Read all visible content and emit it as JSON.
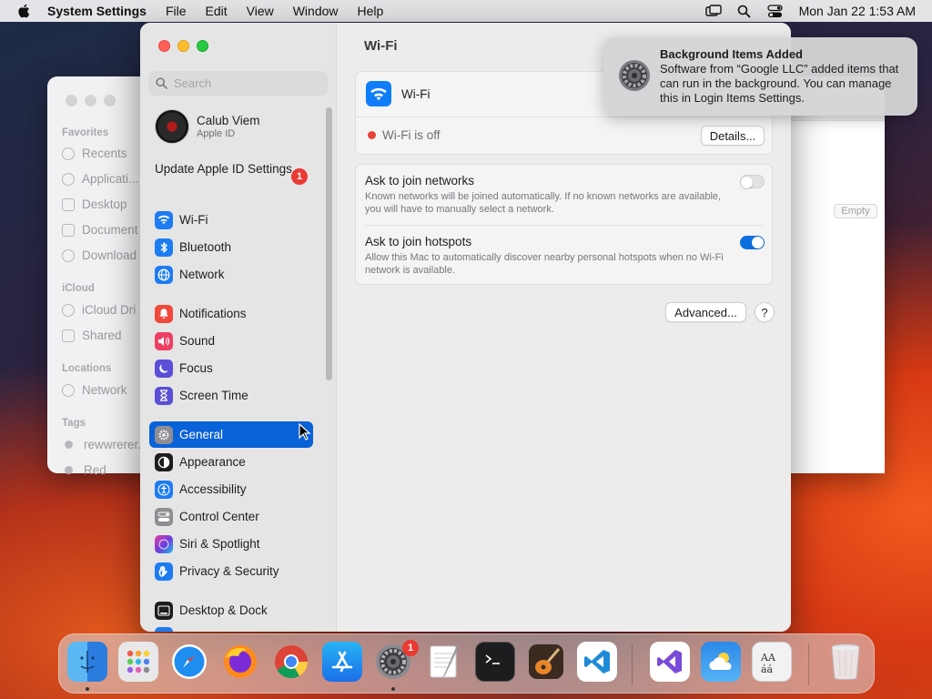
{
  "menubar": {
    "app_name": "System Settings",
    "menus": [
      "File",
      "Edit",
      "View",
      "Window",
      "Help"
    ],
    "clock": "Mon Jan 22  1:53 AM",
    "icons": [
      "screen-mirroring-icon",
      "spotlight-search-icon",
      "control-center-icon"
    ]
  },
  "finder": {
    "sections": {
      "favorites": "Favorites",
      "icloud": "iCloud",
      "locations": "Locations",
      "tags": "Tags"
    },
    "items": {
      "recents": "Recents",
      "applications": "Applicati...",
      "desktop": "Desktop",
      "documents": "Document",
      "downloads": "Download",
      "icloud_drive": "iCloud Dri",
      "shared": "Shared",
      "network": "Network",
      "tag1": "rewwrerer...",
      "tag2": "Red"
    },
    "empty_button": "Empty"
  },
  "settings": {
    "search_placeholder": "Search",
    "account": {
      "name": "Calub Viem",
      "subtitle": "Apple ID"
    },
    "update": {
      "label": "Update Apple ID Settings",
      "badge": "1"
    },
    "nav": [
      {
        "label": "Wi-Fi",
        "icon": "wifi-icon",
        "color": "#1e7cf2"
      },
      {
        "label": "Bluetooth",
        "icon": "bluetooth-icon",
        "color": "#1e7cf2"
      },
      {
        "label": "Network",
        "icon": "globe-icon",
        "color": "#1e7cf2"
      },
      {
        "label": "Notifications",
        "icon": "bell-icon",
        "color": "#f1483c"
      },
      {
        "label": "Sound",
        "icon": "speaker-icon",
        "color": "#ef3e62"
      },
      {
        "label": "Focus",
        "icon": "moon-icon",
        "color": "#5a4fd6"
      },
      {
        "label": "Screen Time",
        "icon": "hourglass-icon",
        "color": "#5a4fd6"
      },
      {
        "label": "General",
        "icon": "gear-icon",
        "color": "#8e8e93"
      },
      {
        "label": "Appearance",
        "icon": "appearance-icon",
        "color": "#1d1d1f"
      },
      {
        "label": "Accessibility",
        "icon": "accessibility-icon",
        "color": "#1e7cf2"
      },
      {
        "label": "Control Center",
        "icon": "control-center-icon",
        "color": "#8e8e93"
      },
      {
        "label": "Siri & Spotlight",
        "icon": "siri-icon",
        "color": "#b03ad8"
      },
      {
        "label": "Privacy & Security",
        "icon": "hand-icon",
        "color": "#1e7cf2"
      },
      {
        "label": "Desktop & Dock",
        "icon": "dock-icon",
        "color": "#1d1d1f"
      }
    ],
    "active_nav": "General",
    "page_title": "Wi-Fi",
    "wifi": {
      "label": "Wi-Fi",
      "status": "Wi-Fi is off",
      "status_color": "#e8443a",
      "details_button": "Details..."
    },
    "options": [
      {
        "title": "Ask to join networks",
        "description": "Known networks will be joined automatically. If no known networks are available, you will have to manually select a network.",
        "enabled": false
      },
      {
        "title": "Ask to join hotspots",
        "description": "Allow this Mac to automatically discover nearby personal hotspots when no Wi-Fi network is available.",
        "enabled": true
      }
    ],
    "advanced_button": "Advanced...",
    "help_button": "?"
  },
  "notification": {
    "title": "Background Items Added",
    "body": "Software from “Google LLC” added items that can run in the background. You can manage this in Login Items Settings.",
    "icon": "gear-icon"
  },
  "dock": {
    "apps": [
      "Finder",
      "Launchpad",
      "Safari",
      "Firefox",
      "Google Chrome",
      "App Store",
      "System Settings",
      "TextEdit",
      "Terminal",
      "GarageBand",
      "Visual Studio Code",
      "Visual Studio",
      "Weather",
      "Font Book",
      "Trash"
    ],
    "system_settings_badge": "1"
  },
  "colors": {
    "accent": "#0a62d8",
    "close": "#fe5f57",
    "minimize": "#febc2e",
    "maximize": "#28c840"
  }
}
